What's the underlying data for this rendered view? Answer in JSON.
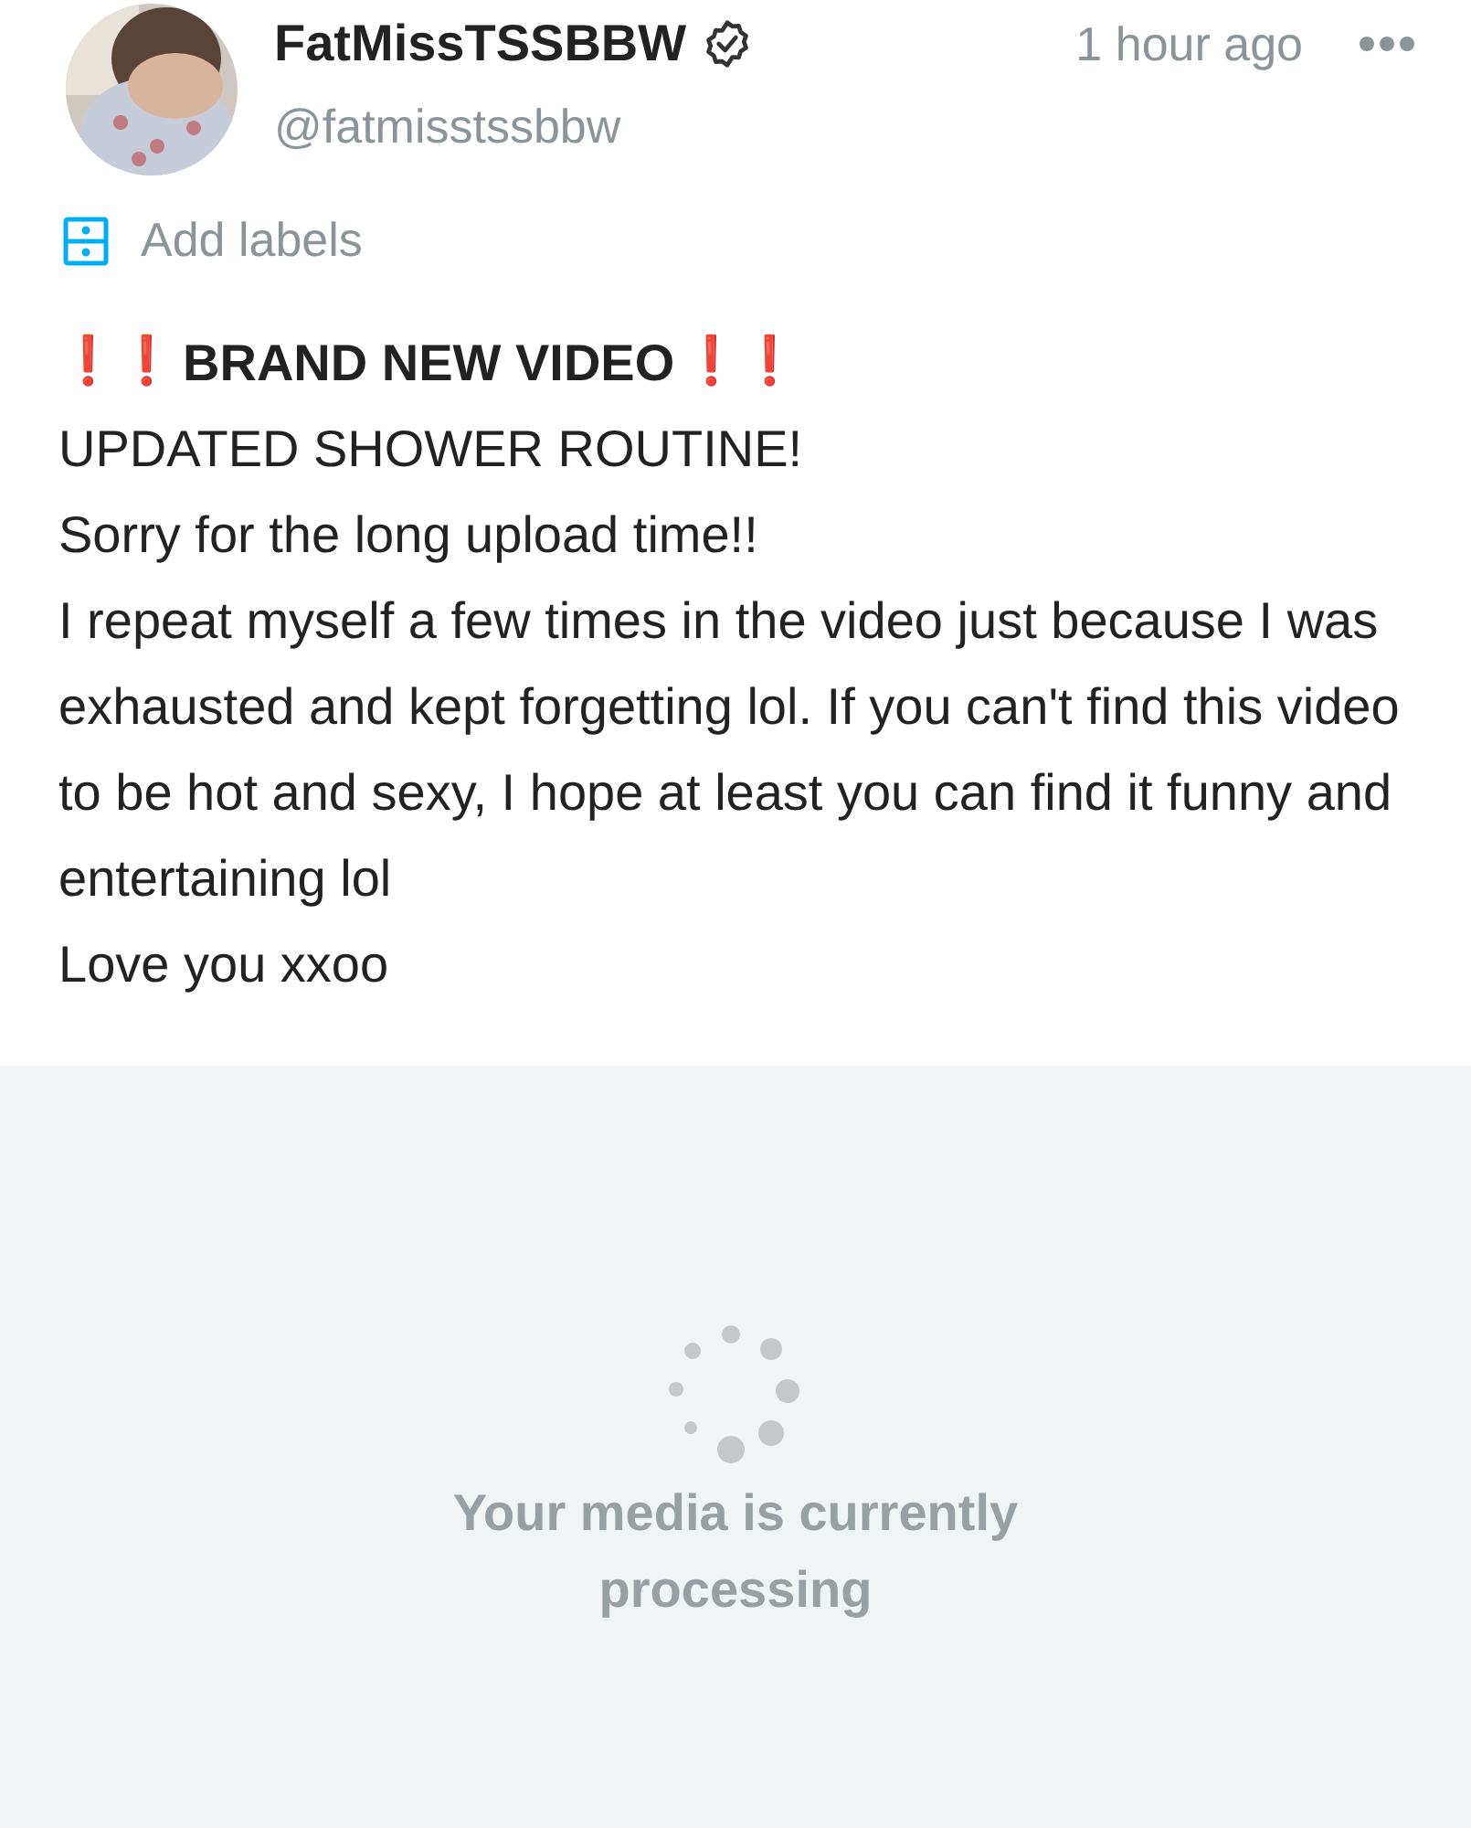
{
  "post": {
    "author": {
      "name": "FatMissTSSBBW",
      "verified": true,
      "handle": "@fatmisstssbbw"
    },
    "time": "1 hour ago",
    "labels_link": "Add labels",
    "headline": {
      "mark": "❗❗",
      "text": "BRAND NEW VIDEO",
      "mark_end": "❗❗"
    },
    "lines": [
      "UPDATED SHOWER ROUTINE!",
      "Sorry for the long upload time!!",
      "I repeat myself a few times in the video just because I was exhausted and kept forgetting lol. If you can't find this video to be hot and sexy, I hope at least you can find it funny and entertaining lol",
      "Love you xxoo"
    ],
    "media": {
      "status": "Your media is currently processing"
    }
  }
}
